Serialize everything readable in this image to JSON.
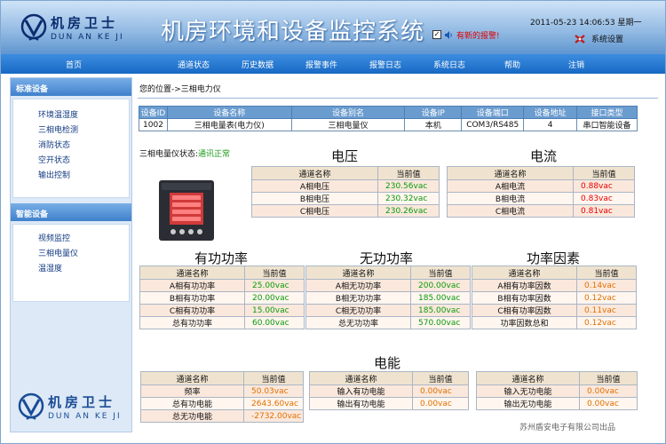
{
  "header": {
    "logo_cn": "机房卫士",
    "logo_en": "DUN AN KE JI",
    "title": "机房环境和设备监控系统",
    "alarm_text": "有新的报警!",
    "datetime": "2011-05-23 14:06:53 星期一",
    "settings_label": "系统设置"
  },
  "nav": [
    "首页",
    "通道状态",
    "历史数据",
    "报警事件",
    "报警日志",
    "系统日志",
    "帮助",
    "注销"
  ],
  "sidebar": {
    "sections": [
      {
        "title": "标准设备",
        "items": [
          "环境温湿度",
          "三相电检测",
          "消防状态",
          "空开状态",
          "输出控制"
        ]
      },
      {
        "title": "智能设备",
        "items": [
          "视频监控",
          "三相电量仪",
          "温湿度"
        ]
      }
    ],
    "logo_cn": "机房卫士",
    "logo_en": "DUN AN KE JI"
  },
  "breadcrumb": "您的位置->三相电力仪",
  "device_info": {
    "headers": [
      "设备ID",
      "设备名称",
      "设备别名",
      "设备IP",
      "设备端口",
      "设备地址",
      "接口类型"
    ],
    "row": [
      "1002",
      "三相电量表(电力仪)",
      "三相电量仪",
      "本机",
      "COM3/RS485",
      "4",
      "串口智能设备"
    ]
  },
  "meter_status": {
    "label": "三相电量仪状态:",
    "value": "通讯正常"
  },
  "col_name": "通道名称",
  "col_value": "当前值",
  "voltage": {
    "title": "电压",
    "rows": [
      [
        "A相电压",
        "230.56vac"
      ],
      [
        "B相电压",
        "230.32vac"
      ],
      [
        "C相电压",
        "230.26vac"
      ]
    ]
  },
  "current": {
    "title": "电流",
    "rows": [
      [
        "A相电流",
        "0.88vac"
      ],
      [
        "B相电流",
        "0.83vac"
      ],
      [
        "C相电流",
        "0.81vac"
      ]
    ]
  },
  "active_power": {
    "title": "有功功率",
    "rows": [
      [
        "A相有功功率",
        "25.00vac"
      ],
      [
        "B相有功功率",
        "20.00vac"
      ],
      [
        "C相有功功率",
        "15.00vac"
      ],
      [
        "总有功功率",
        "60.00vac"
      ]
    ]
  },
  "reactive_power": {
    "title": "无功功率",
    "rows": [
      [
        "A相无功功率",
        "200.00vac"
      ],
      [
        "B相无功功率",
        "185.00vac"
      ],
      [
        "C相无功功率",
        "185.00vac"
      ],
      [
        "总无功功率",
        "570.00vac"
      ]
    ]
  },
  "power_factor": {
    "title": "功率因素",
    "rows": [
      [
        "A相有功率因数",
        "0.14vac"
      ],
      [
        "B相有功率因数",
        "0.12vac"
      ],
      [
        "C相有功率因数",
        "0.11vac"
      ],
      [
        "功率因数总和",
        "0.12vac"
      ]
    ]
  },
  "energy": {
    "title": "电能",
    "table1": [
      [
        "频率",
        "50.03vac"
      ],
      [
        "总有功电能",
        "2643.60vac"
      ],
      [
        "总无功电能",
        "-2732.00vac"
      ]
    ],
    "table2": [
      [
        "输入有功电能",
        "0.00vac"
      ],
      [
        "输出有功电能",
        "0.00vac"
      ]
    ],
    "table3": [
      [
        "输入无功电能",
        "0.00vac"
      ],
      [
        "输出无功电能",
        "0.00vac"
      ]
    ]
  },
  "footer": "苏州盾安电子有限公司出品",
  "colors": {
    "nav": "#1769c4",
    "value_green": "#0a9a0a",
    "value_red": "#e60000",
    "value_orange": "#e07000",
    "row_bg": "#fbe8dc"
  }
}
